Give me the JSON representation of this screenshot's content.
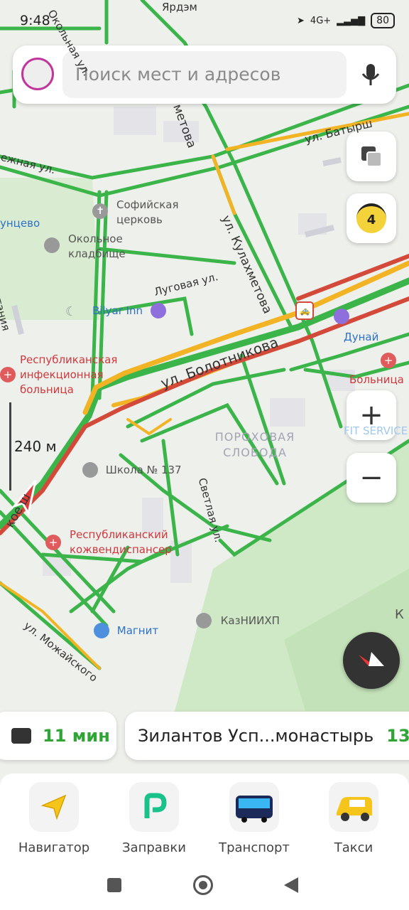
{
  "status": {
    "time": "9:48",
    "network": "4G+",
    "battery": "80"
  },
  "search": {
    "placeholder": "Поиск мест и адресов"
  },
  "map": {
    "traffic_level": "4",
    "scale": "240 м",
    "streets": [
      "Ярдэм",
      "Окольная ул.",
      "Луговая ул.",
      "ул. Кулахметова",
      "ул. Батырш",
      "ул. Болотникова",
      "Светлая ул.",
      "ул. Можайского",
      "метова",
      "ежная ул.",
      "истания",
      "кое ш"
    ],
    "pois": [
      {
        "name": "Софийская церковь"
      },
      {
        "name": "Окольное кладбище"
      },
      {
        "name": "Bilyar Inn"
      },
      {
        "name": "Республиканская инфекционная больница"
      },
      {
        "name": "Дунай"
      },
      {
        "name": "Больница"
      },
      {
        "name": "Школа № 137"
      },
      {
        "name": "Республиканский кожвендиспансер"
      },
      {
        "name": "Магнит"
      },
      {
        "name": "КазНИИХП"
      },
      {
        "name": "унцево"
      },
      {
        "name": "FIT SERVICE"
      }
    ],
    "district": "ПОРОХОВАЯ СЛОБОДА",
    "edge_label": "К"
  },
  "route_chips": {
    "work_time": "11 мин",
    "destination": "Зилантов Усп...монастырь",
    "destination_time": "13"
  },
  "tabs": [
    {
      "label": "Навигатор"
    },
    {
      "label": "Заправки"
    },
    {
      "label": "Транспорт"
    },
    {
      "label": "Такси"
    }
  ]
}
